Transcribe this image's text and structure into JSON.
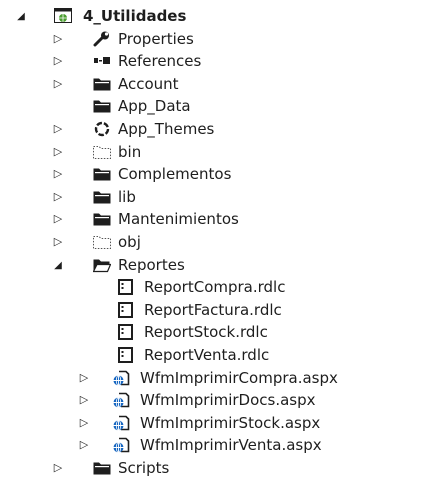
{
  "tree": {
    "project": {
      "label": "4_Utilidades",
      "icon": "web-project-icon"
    },
    "items": [
      {
        "label": "Properties",
        "icon": "wrench-icon"
      },
      {
        "label": "References",
        "icon": "references-icon"
      },
      {
        "label": "Account",
        "icon": "folder-icon"
      },
      {
        "label": "App_Data",
        "icon": "folder-icon"
      },
      {
        "label": "App_Themes",
        "icon": "themes-icon"
      },
      {
        "label": "bin",
        "icon": "hidden-folder-icon"
      },
      {
        "label": "Complementos",
        "icon": "folder-icon"
      },
      {
        "label": "lib",
        "icon": "folder-icon"
      },
      {
        "label": "Mantenimientos",
        "icon": "folder-icon"
      },
      {
        "label": "obj",
        "icon": "hidden-folder-icon"
      },
      {
        "label": "Reportes",
        "icon": "open-folder-icon"
      },
      {
        "label": "ReportCompra.rdlc",
        "icon": "report-file-icon"
      },
      {
        "label": "ReportFactura.rdlc",
        "icon": "report-file-icon"
      },
      {
        "label": "ReportStock.rdlc",
        "icon": "report-file-icon"
      },
      {
        "label": "ReportVenta.rdlc",
        "icon": "report-file-icon"
      },
      {
        "label": "WfmImprimirCompra.aspx",
        "icon": "web-form-icon"
      },
      {
        "label": "WfmImprimirDocs.aspx",
        "icon": "web-form-icon"
      },
      {
        "label": "WfmImprimirStock.aspx",
        "icon": "web-form-icon"
      },
      {
        "label": "WfmImprimirVenta.aspx",
        "icon": "web-form-icon"
      },
      {
        "label": "Scripts",
        "icon": "folder-icon"
      }
    ]
  }
}
